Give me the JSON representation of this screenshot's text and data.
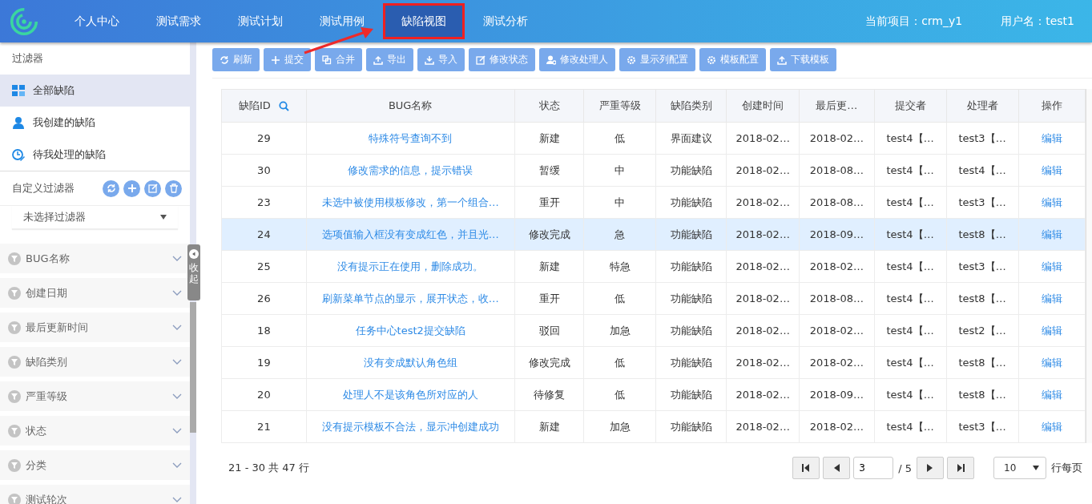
{
  "header": {
    "nav": [
      {
        "label": "个人中心",
        "selected": false
      },
      {
        "label": "测试需求",
        "selected": false
      },
      {
        "label": "测试计划",
        "selected": false
      },
      {
        "label": "测试用例",
        "selected": false
      },
      {
        "label": "缺陷视图",
        "selected": true
      },
      {
        "label": "测试分析",
        "selected": false
      }
    ],
    "project": "当前项目：crm_y1",
    "user": "用户名：test1"
  },
  "sidebar": {
    "title": "过滤器",
    "items": [
      {
        "label": "全部缺陷",
        "selected": true
      },
      {
        "label": "我创建的缺陷",
        "selected": false
      },
      {
        "label": "待我处理的缺陷",
        "selected": false
      }
    ],
    "custom_filter": {
      "label": "自定义过滤器",
      "select_value": "未选择过滤器"
    },
    "collapse_label": "收起",
    "sections": [
      "BUG名称",
      "创建日期",
      "最后更新时间",
      "缺陷类别",
      "严重等级",
      "状态",
      "分类",
      "测试轮次"
    ]
  },
  "toolbar": [
    "刷新",
    "提交",
    "合并",
    "导出",
    "导入",
    "修改状态",
    "修改处理人",
    "显示列配置",
    "模板配置",
    "下载模板"
  ],
  "table": {
    "columns": [
      "缺陷ID",
      "BUG名称",
      "状态",
      "严重等级",
      "缺陷类别",
      "创建时间",
      "最后更…",
      "提交者",
      "处理者",
      "操作"
    ],
    "rows": [
      {
        "selected": false,
        "cells": [
          "29",
          "特殊符号查询不到",
          "新建",
          "低",
          "界面建议",
          "2018-02…",
          "2018-02…",
          "test4【…",
          "test3【…",
          "编辑"
        ]
      },
      {
        "selected": false,
        "cells": [
          "30",
          "修改需求的信息，提示错误",
          "暂缓",
          "中",
          "功能缺陷",
          "2018-02…",
          "2018-08…",
          "test4【…",
          "test4【…",
          "编辑"
        ]
      },
      {
        "selected": false,
        "cells": [
          "23",
          "未选中被使用模板修改，第一个组合…",
          "重开",
          "中",
          "功能缺陷",
          "2018-02…",
          "2018-08…",
          "test4【…",
          "test3【…",
          "编辑"
        ]
      },
      {
        "selected": true,
        "cells": [
          "24",
          "选项值输入框没有变成红色，并且光…",
          "修改完成",
          "急",
          "功能缺陷",
          "2018-02…",
          "2018-09…",
          "test4【…",
          "test8【…",
          "编辑"
        ]
      },
      {
        "selected": false,
        "cells": [
          "25",
          "没有提示正在使用，删除成功。",
          "新建",
          "特急",
          "功能缺陷",
          "2018-02…",
          "2018-02…",
          "test4【…",
          "test3【…",
          "编辑"
        ]
      },
      {
        "selected": false,
        "cells": [
          "26",
          "刷新菜单节点的显示，展开状态，收…",
          "重开",
          "低",
          "功能缺陷",
          "2018-02…",
          "2018-08…",
          "test4【…",
          "test8【…",
          "编辑"
        ]
      },
      {
        "selected": false,
        "cells": [
          "18",
          "任务中心test2提交缺陷",
          "驳回",
          "加急",
          "功能缺陷",
          "2018-02…",
          "2018-02…",
          "test4【…",
          "test2【…",
          "编辑"
        ]
      },
      {
        "selected": false,
        "cells": [
          "19",
          "没有变成默认角色组",
          "修改完成",
          "低",
          "功能缺陷",
          "2018-02…",
          "2018-02…",
          "test4【…",
          "test8【…",
          "编辑"
        ]
      },
      {
        "selected": false,
        "cells": [
          "20",
          "处理人不是该角色所对应的人",
          "待修复",
          "低",
          "功能缺陷",
          "2018-02…",
          "2018-09…",
          "test4【…",
          "test8【…",
          "编辑"
        ]
      },
      {
        "selected": false,
        "cells": [
          "21",
          "没有提示模板不合法，显示冲创建成功",
          "新建",
          "加急",
          "功能缺陷",
          "2018-02…",
          "2018-02…",
          "test4【…",
          "test3【…",
          "编辑"
        ]
      }
    ]
  },
  "pagination": {
    "summary": "21 - 30 共 47 行",
    "page": "3",
    "total": "/ 5",
    "page_size": "10",
    "page_size_label": "行每页"
  }
}
